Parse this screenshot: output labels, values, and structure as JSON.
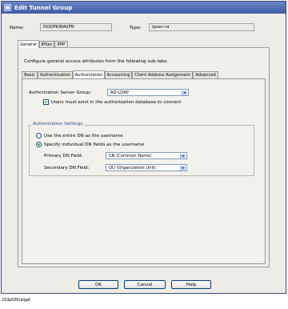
{
  "window": {
    "title": "Edit Tunnel Group"
  },
  "header": {
    "name_label": "Name:",
    "name_value": "DODPKIRAVPN",
    "type_label": "Type:",
    "type_value": "ipsec-ra"
  },
  "main_tabs": [
    {
      "label": "General",
      "active": true
    },
    {
      "label": "IPSec",
      "active": false
    },
    {
      "label": "PPP",
      "active": false
    }
  ],
  "description": "Configure general access attributes from the following sub-tabs.",
  "sub_tabs": [
    {
      "label": "Basic",
      "active": false
    },
    {
      "label": "Authentication",
      "active": false
    },
    {
      "label": "Authorization",
      "active": true
    },
    {
      "label": "Accounting",
      "active": false
    },
    {
      "label": "Client Address Assignment",
      "active": false
    },
    {
      "label": "Advanced",
      "active": false
    }
  ],
  "authorization": {
    "server_group_label": "Authorization Server Group:",
    "server_group_value": "AD-LDAP",
    "must_exist_label": "Users must exist in the authorization database to connect",
    "must_exist_checked": true
  },
  "settings": {
    "legend": "Authorization Settings",
    "radio_entire_dn_label": "Use the entire DN as the username",
    "radio_entire_dn_selected": false,
    "radio_individual_label": "Specify individual DN fields as the username",
    "radio_individual_selected": true,
    "primary_label": "Primary DN Field:",
    "primary_value": "CN (Common Name)",
    "secondary_label": "Secondary DN Field:",
    "secondary_value": "OU (Organization Unit)"
  },
  "buttons": {
    "ok": "OK",
    "cancel": "Cancel",
    "help": "Help"
  },
  "caption": "153p036/a/ppt"
}
